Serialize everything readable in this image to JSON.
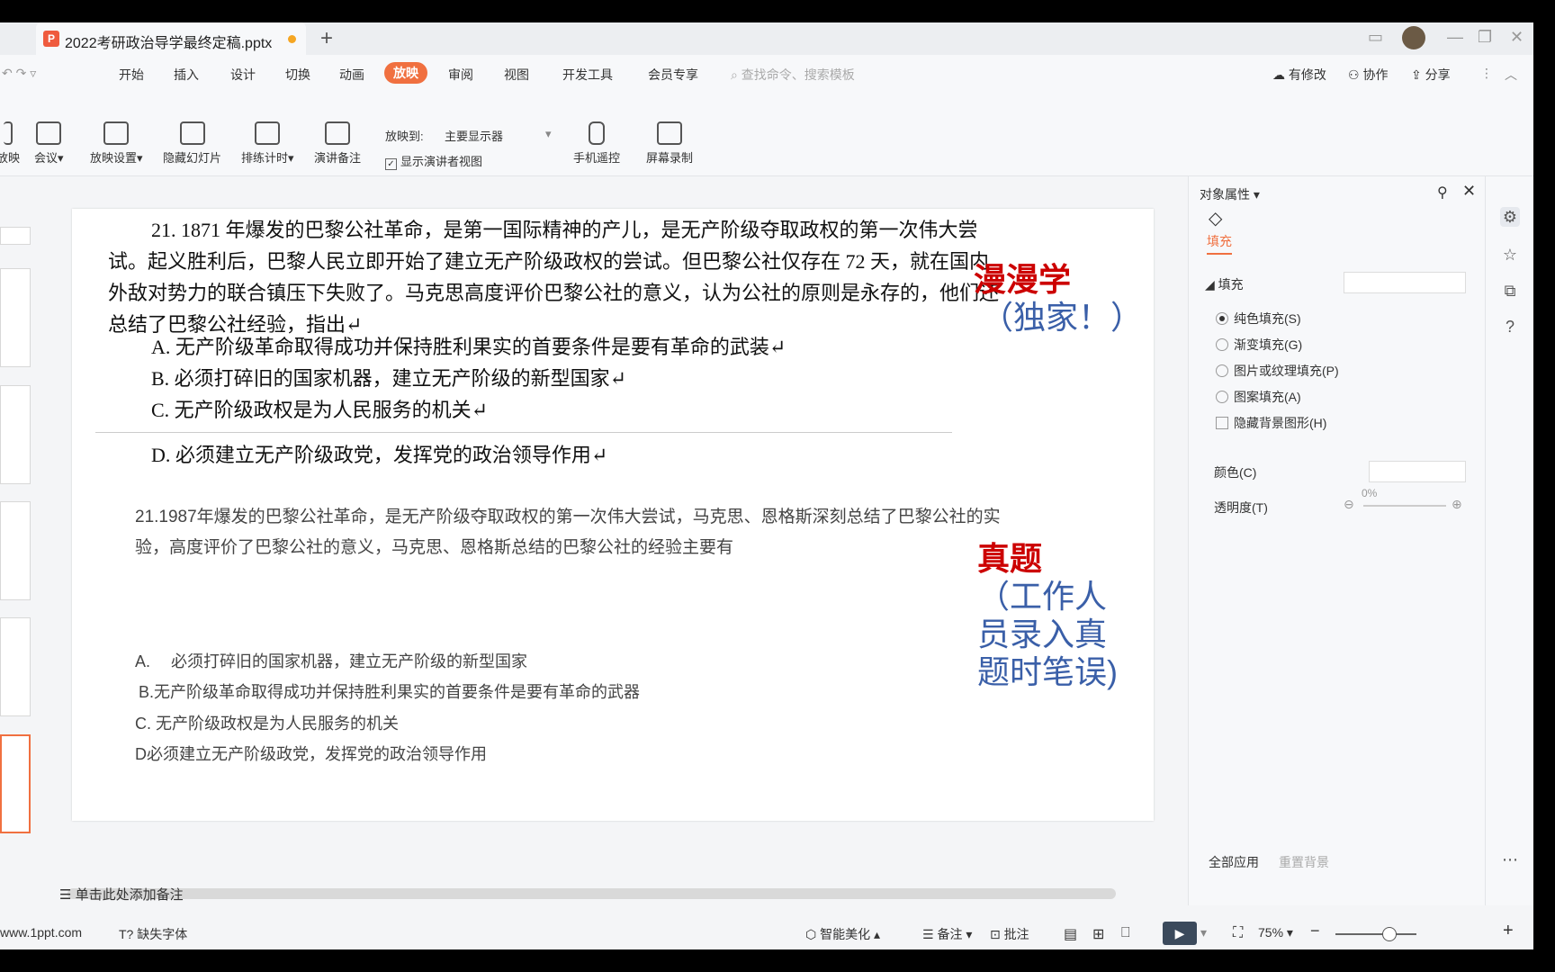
{
  "titlebar": {
    "tab_name": "2022考研政治导学最终定稿.pptx",
    "new_tab": "+"
  },
  "menu": {
    "items": [
      "开始",
      "插入",
      "设计",
      "切换",
      "动画",
      "放映",
      "审阅",
      "视图",
      "开发工具",
      "会员专享"
    ],
    "active": "放映",
    "search_placeholder": "查找命令、搜索模板",
    "right": [
      "有修改",
      "协作",
      "分享"
    ]
  },
  "ribbon": {
    "buttons": [
      "放映",
      "会议",
      "放映设置",
      "隐藏幻灯片",
      "排练计时",
      "演讲备注",
      "手机遥控",
      "屏幕录制"
    ],
    "show_to_label": "放映到:",
    "show_to_value": "主要显示器",
    "presenter_view": "显示演讲者视图"
  },
  "slide": {
    "q1_text": "21. 1871 年爆发的巴黎公社革命，是第一国际精神的产儿，是无产阶级夺取政权的第一次伟大尝试。起义胜利后，巴黎人民立即开始了建立无产阶级政权的尝试。但巴黎公社仅存在 72 天，就在国内外敌对势力的联合镇压下失败了。马克思高度评价巴黎公社的意义，认为公社的原则是永存的，他们还总结了巴黎公社经验，指出↵",
    "q1_options": [
      "A. 无产阶级革命取得成功并保持胜利果实的首要条件是要有革命的武装↵",
      "B. 必须打碎旧的国家机器，建立无产阶级的新型国家↵",
      "C. 无产阶级政权是为人民服务的机关↵",
      "D. 必须建立无产阶级政党，发挥党的政治领导作用↵"
    ],
    "q2_text": "21.1987年爆发的巴黎公社革命，是无产阶级夺取政权的第一次伟大尝试，马克思、恩格斯深刻总结了巴黎公社的实验，高度评价了巴黎公社的意义，马克思、恩格斯总结的巴黎公社的经验主要有",
    "q2_options": [
      "A.　 必须打碎旧的国家机器，建立无产阶级的新型国家",
      "B.无产阶级革命取得成功并保持胜利果实的首要条件是要有革命的武器",
      "C.  无产阶级政权是为人民服务的机关",
      "D必须建立无产阶级政党，发挥党的政治领导作用"
    ],
    "label1_red": "漫漫学",
    "label1_blue": "（独家！）",
    "label2_red": "真题",
    "label2_blue_lines": [
      "（工作人",
      "员录入真",
      "题时笔误)"
    ]
  },
  "panel": {
    "title": "对象属性",
    "tab": "填充",
    "section": "填充",
    "options": [
      "纯色填充(S)",
      "渐变填充(G)",
      "图片或纹理填充(P)",
      "图案填充(A)"
    ],
    "selected": 0,
    "hide_bg": "隐藏背景图形(H)",
    "color_label": "颜色(C)",
    "transparency_label": "透明度(T)",
    "transparency_value": "0%",
    "apply_all": "全部应用",
    "reset_bg": "重置背景"
  },
  "notes": "单击此处添加备注",
  "status": {
    "site": "www.1ppt.com",
    "missing_font": "缺失字体",
    "beautify": "智能美化",
    "notes": "备注",
    "comment": "批注",
    "zoom": "75%"
  },
  "colors": {
    "accent": "#f07040",
    "red": "#cc0000",
    "blue": "#3a5fa8"
  }
}
